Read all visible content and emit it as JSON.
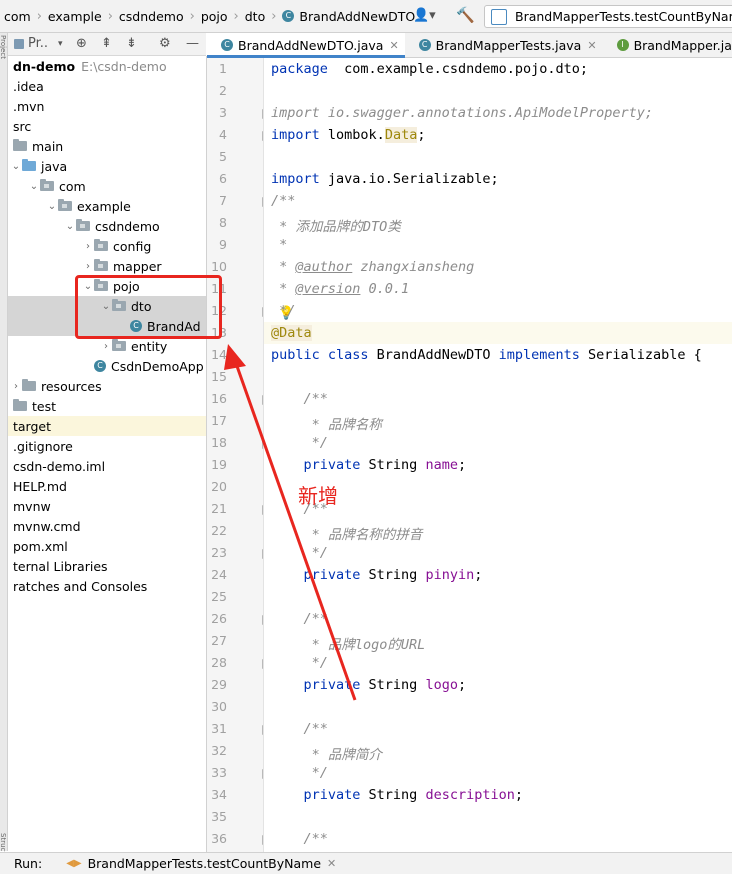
{
  "breadcrumbs": {
    "items": [
      "com",
      "example",
      "csdndemo",
      "pojo",
      "dto",
      "BrandAddNewDTO"
    ]
  },
  "run_config": {
    "label": "BrandMapperTests.testCountByName"
  },
  "project_panel": {
    "title": "Pr..",
    "tree": [
      {
        "label": "dn-demo",
        "extra": "E:\\csdn-demo",
        "indent": 0,
        "bold": true
      },
      {
        "label": ".idea",
        "indent": 0
      },
      {
        "label": ".mvn",
        "indent": 0
      },
      {
        "label": "src",
        "indent": 0
      },
      {
        "label": "main",
        "indent": 0,
        "folder": true
      },
      {
        "label": "java",
        "indent": 1,
        "folder": true,
        "blue": true,
        "open": true
      },
      {
        "label": "com",
        "indent": 2,
        "folder": true,
        "open": true
      },
      {
        "label": "example",
        "indent": 3,
        "folder": true,
        "open": true
      },
      {
        "label": "csdndemo",
        "indent": 4,
        "folder": true,
        "open": true
      },
      {
        "label": "config",
        "indent": 5,
        "folder": true,
        "closed": true
      },
      {
        "label": "mapper",
        "indent": 5,
        "folder": true,
        "closed": true
      },
      {
        "label": "pojo",
        "indent": 5,
        "folder": true,
        "open": true
      },
      {
        "label": "dto",
        "indent": 6,
        "folder": true,
        "open": true,
        "selected": true
      },
      {
        "label": "BrandAd",
        "indent": 7,
        "class": true,
        "selected": true
      },
      {
        "label": "entity",
        "indent": 6,
        "folder": true,
        "closed": true
      },
      {
        "label": "CsdnDemoApp",
        "indent": 5,
        "class": true
      },
      {
        "label": "resources",
        "indent": 1,
        "folder": true,
        "closed": true
      },
      {
        "label": "test",
        "indent": 0,
        "folder": true
      },
      {
        "label": "target",
        "indent": 0,
        "target": true
      },
      {
        "label": ".gitignore",
        "indent": 0
      },
      {
        "label": "csdn-demo.iml",
        "indent": 0
      },
      {
        "label": "HELP.md",
        "indent": 0
      },
      {
        "label": "mvnw",
        "indent": 0
      },
      {
        "label": "mvnw.cmd",
        "indent": 0
      },
      {
        "label": "pom.xml",
        "indent": 0
      },
      {
        "label": "ternal Libraries",
        "indent": 0
      },
      {
        "label": "ratches and Consoles",
        "indent": 0
      }
    ]
  },
  "tabs": [
    {
      "label": "BrandAddNewDTO.java",
      "active": true,
      "icon": "class-icon"
    },
    {
      "label": "BrandMapperTests.java",
      "active": false,
      "icon": "class-icon"
    },
    {
      "label": "BrandMapper.java",
      "active": false,
      "icon": "interface-icon"
    }
  ],
  "code_lines": [
    {
      "n": "1",
      "parts": [
        [
          "kw",
          "package"
        ],
        [
          "",
          "  com.example.csdndemo.pojo.dto;"
        ]
      ]
    },
    {
      "n": "2",
      "parts": []
    },
    {
      "n": "3",
      "parts": [
        [
          "cm",
          "import io.swagger.annotations.ApiModelProperty;"
        ]
      ]
    },
    {
      "n": "4",
      "parts": [
        [
          "kw",
          "import"
        ],
        [
          "",
          " lombok."
        ],
        [
          "an hl",
          "Data"
        ],
        [
          "",
          ";"
        ]
      ]
    },
    {
      "n": "5",
      "parts": []
    },
    {
      "n": "6",
      "parts": [
        [
          "kw",
          "import"
        ],
        [
          "",
          " java.io.Serializable;"
        ]
      ]
    },
    {
      "n": "7",
      "parts": [
        [
          "cm",
          "/**"
        ]
      ]
    },
    {
      "n": "8",
      "parts": [
        [
          "cm",
          " * 添加品牌的DTO类"
        ]
      ]
    },
    {
      "n": "9",
      "parts": [
        [
          "cm",
          " *"
        ]
      ]
    },
    {
      "n": "10",
      "parts": [
        [
          "cm",
          " * "
        ],
        [
          "tag",
          "@author"
        ],
        [
          "cm",
          " zhangxiansheng"
        ]
      ]
    },
    {
      "n": "11",
      "parts": [
        [
          "cm",
          " * "
        ],
        [
          "tag",
          "@version"
        ],
        [
          "cm",
          " 0.0.1"
        ]
      ]
    },
    {
      "n": "12",
      "parts": [
        [
          "cm",
          " */"
        ]
      ]
    },
    {
      "n": "13",
      "parts": [
        [
          "an hl",
          "@Data"
        ]
      ]
    },
    {
      "n": "14",
      "parts": [
        [
          "kw",
          "public class"
        ],
        [
          "",
          " BrandAddNewDTO "
        ],
        [
          "kw",
          "implements"
        ],
        [
          "",
          " Serializable {"
        ]
      ]
    },
    {
      "n": "15",
      "parts": []
    },
    {
      "n": "16",
      "parts": [
        [
          "cm",
          "    /**"
        ]
      ]
    },
    {
      "n": "17",
      "parts": [
        [
          "cm",
          "     * 品牌名称"
        ]
      ]
    },
    {
      "n": "18",
      "parts": [
        [
          "cm",
          "     */"
        ]
      ]
    },
    {
      "n": "19",
      "parts": [
        [
          "kw",
          "    private"
        ],
        [
          "",
          " String "
        ],
        [
          "fld",
          "name"
        ],
        [
          "",
          ";"
        ]
      ]
    },
    {
      "n": "20",
      "parts": []
    },
    {
      "n": "21",
      "parts": [
        [
          "cm",
          "    /**"
        ]
      ]
    },
    {
      "n": "22",
      "parts": [
        [
          "cm",
          "     * 品牌名称的拼音"
        ]
      ]
    },
    {
      "n": "23",
      "parts": [
        [
          "cm",
          "     */"
        ]
      ]
    },
    {
      "n": "24",
      "parts": [
        [
          "kw",
          "    private"
        ],
        [
          "",
          " String "
        ],
        [
          "fld",
          "pinyin"
        ],
        [
          "",
          ";"
        ]
      ]
    },
    {
      "n": "25",
      "parts": []
    },
    {
      "n": "26",
      "parts": [
        [
          "cm",
          "    /**"
        ]
      ]
    },
    {
      "n": "27",
      "parts": [
        [
          "cm",
          "     * 品牌logo的URL"
        ]
      ]
    },
    {
      "n": "28",
      "parts": [
        [
          "cm",
          "     */"
        ]
      ]
    },
    {
      "n": "29",
      "parts": [
        [
          "kw",
          "    private"
        ],
        [
          "",
          " String "
        ],
        [
          "fld",
          "logo"
        ],
        [
          "",
          ";"
        ]
      ]
    },
    {
      "n": "30",
      "parts": []
    },
    {
      "n": "31",
      "parts": [
        [
          "cm",
          "    /**"
        ]
      ]
    },
    {
      "n": "32",
      "parts": [
        [
          "cm",
          "     * 品牌简介"
        ]
      ]
    },
    {
      "n": "33",
      "parts": [
        [
          "cm",
          "     */"
        ]
      ]
    },
    {
      "n": "34",
      "parts": [
        [
          "kw",
          "    private"
        ],
        [
          "",
          " String "
        ],
        [
          "fld",
          "description"
        ],
        [
          "",
          ";"
        ]
      ]
    },
    {
      "n": "35",
      "parts": []
    },
    {
      "n": "36",
      "parts": [
        [
          "cm",
          "    /**"
        ]
      ]
    }
  ],
  "annotation": {
    "text": "新增",
    "color": "#e8261f"
  },
  "bottom_bar": {
    "run_label": "Run:",
    "run_tab": "BrandMapperTests.testCountByName"
  },
  "colors": {
    "keyword": "#0033b3",
    "annotation": "#9e880d",
    "field": "#871094",
    "comment": "#8c8c8c",
    "accent": "#4083c9"
  }
}
